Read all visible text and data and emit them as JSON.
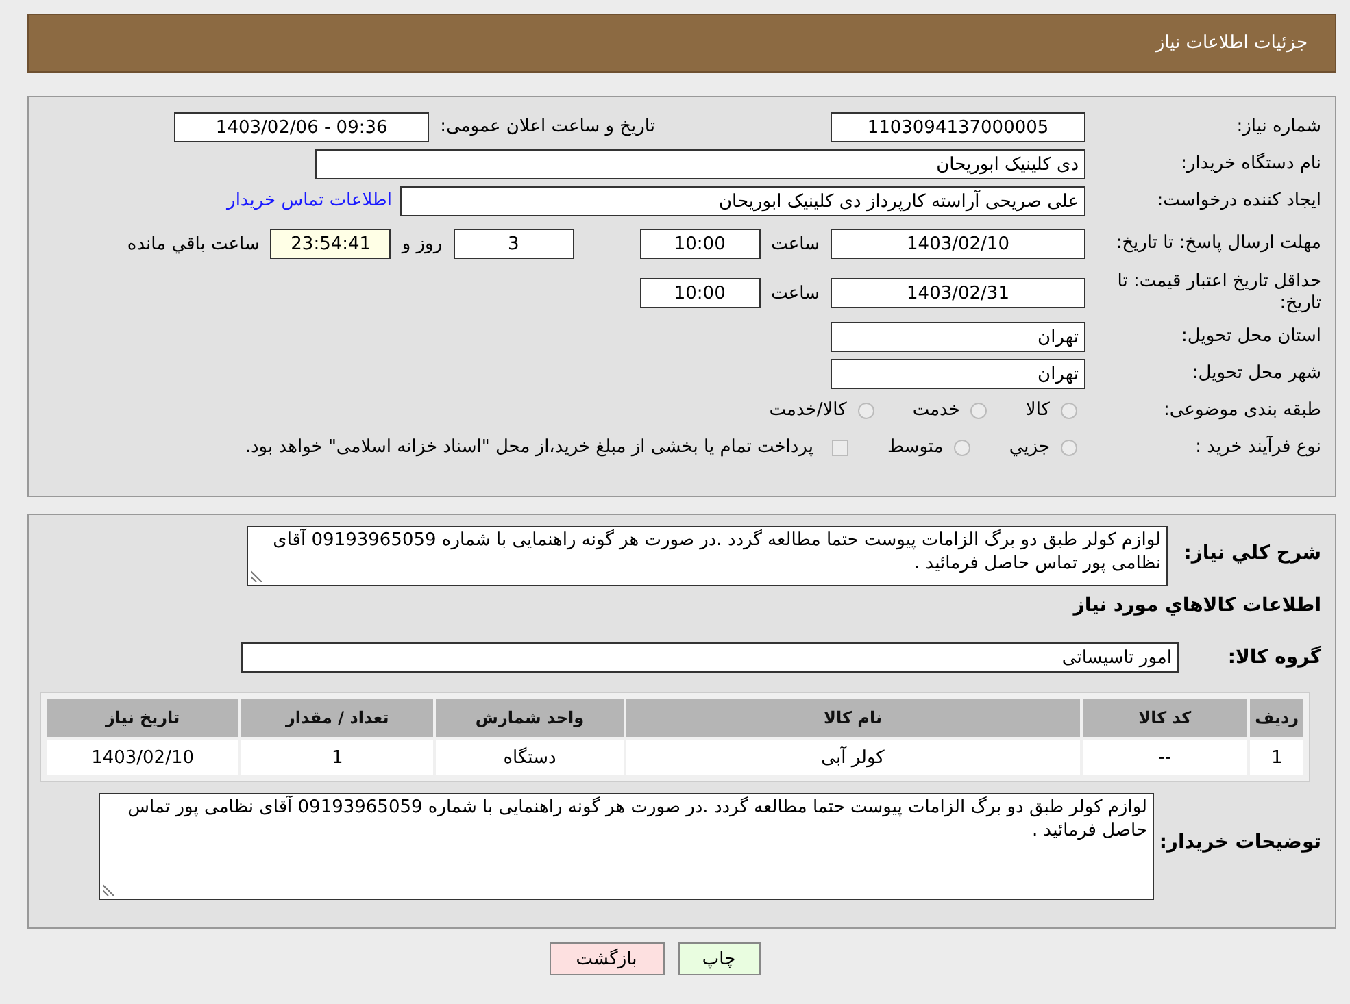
{
  "header": {
    "title": "جزئیات اطلاعات نیاز"
  },
  "need_number": {
    "label": "شماره نیاز:",
    "value": "1103094137000005"
  },
  "announce": {
    "label": "تاریخ و ساعت اعلان عمومی:",
    "value": "1403/02/06 - 09:36"
  },
  "buyer_org": {
    "label": "نام دستگاه خریدار:",
    "value": "دی کلینیک ابوریحان"
  },
  "requester": {
    "label": "ایجاد کننده درخواست:",
    "value": "علی صریحی آراسته کارپرداز دی کلینیک ابوریحان",
    "link": "اطلاعات تماس خریدار"
  },
  "deadline": {
    "label": "مهلت ارسال پاسخ: تا تاریخ:",
    "date": "1403/02/10",
    "time_label": "ساعت",
    "time": "10:00",
    "days": "3",
    "days_label": "روز و",
    "remaining": "23:54:41",
    "remaining_label": "ساعت باقي مانده"
  },
  "price_validity": {
    "label": "حداقل تاریخ اعتبار قیمت: تا تاریخ:",
    "date": "1403/02/31",
    "time_label": "ساعت",
    "time": "10:00"
  },
  "province": {
    "label": "استان محل تحویل:",
    "value": "تهران"
  },
  "city": {
    "label": "شهر محل تحویل:",
    "value": "تهران"
  },
  "category": {
    "label": "طبقه بندی موضوعی:",
    "options": [
      {
        "kind": "radio",
        "text": "کالا",
        "selected": false
      },
      {
        "kind": "radio",
        "text": "خدمت",
        "selected": false
      },
      {
        "kind": "radio",
        "text": "کالا/خدمت",
        "selected": false
      }
    ]
  },
  "purchase_type": {
    "label": "نوع فرآیند خرید :",
    "options": [
      {
        "kind": "radio",
        "text": "جزيي",
        "selected": false
      },
      {
        "kind": "radio",
        "text": "متوسط",
        "selected": false
      },
      {
        "kind": "checkbox",
        "text": "پرداخت تمام یا بخشی از مبلغ خرید،از محل \"اسناد خزانه اسلامی\" خواهد بود.",
        "selected": false
      }
    ]
  },
  "description": {
    "label": "شرح كلي نیاز:",
    "value": "لوازم کولر طبق دو برگ الزامات پیوست حتما  مطالعه گردد .در صورت هر گونه راهنمایی با شماره 09193965059 آقای نظامی پور تماس حاصل فرمائید ."
  },
  "goods_heading": "اطلاعات كالاهاي مورد نیاز",
  "goods_group": {
    "label": "گروه کالا:",
    "value": "امور تاسیساتی"
  },
  "table": {
    "columns": [
      "ردیف",
      "کد کالا",
      "نام کالا",
      "واحد شمارش",
      "تعداد / مقدار",
      "تاریخ نیاز"
    ],
    "rows": [
      [
        "1",
        "--",
        "کولر آبی",
        "دستگاه",
        "1",
        "1403/02/10"
      ]
    ]
  },
  "buyer_notes": {
    "label": "توضیحات خریدار:",
    "value": "لوازم کولر طبق دو برگ الزامات پیوست حتما  مطالعه گردد .در صورت هر گونه راهنمایی با شماره 09193965059 آقای نظامی پور تماس حاصل فرمائید ."
  },
  "buttons": [
    {
      "kind": "print",
      "label": "چاپ"
    },
    {
      "kind": "back",
      "label": "بازگشت"
    }
  ]
}
